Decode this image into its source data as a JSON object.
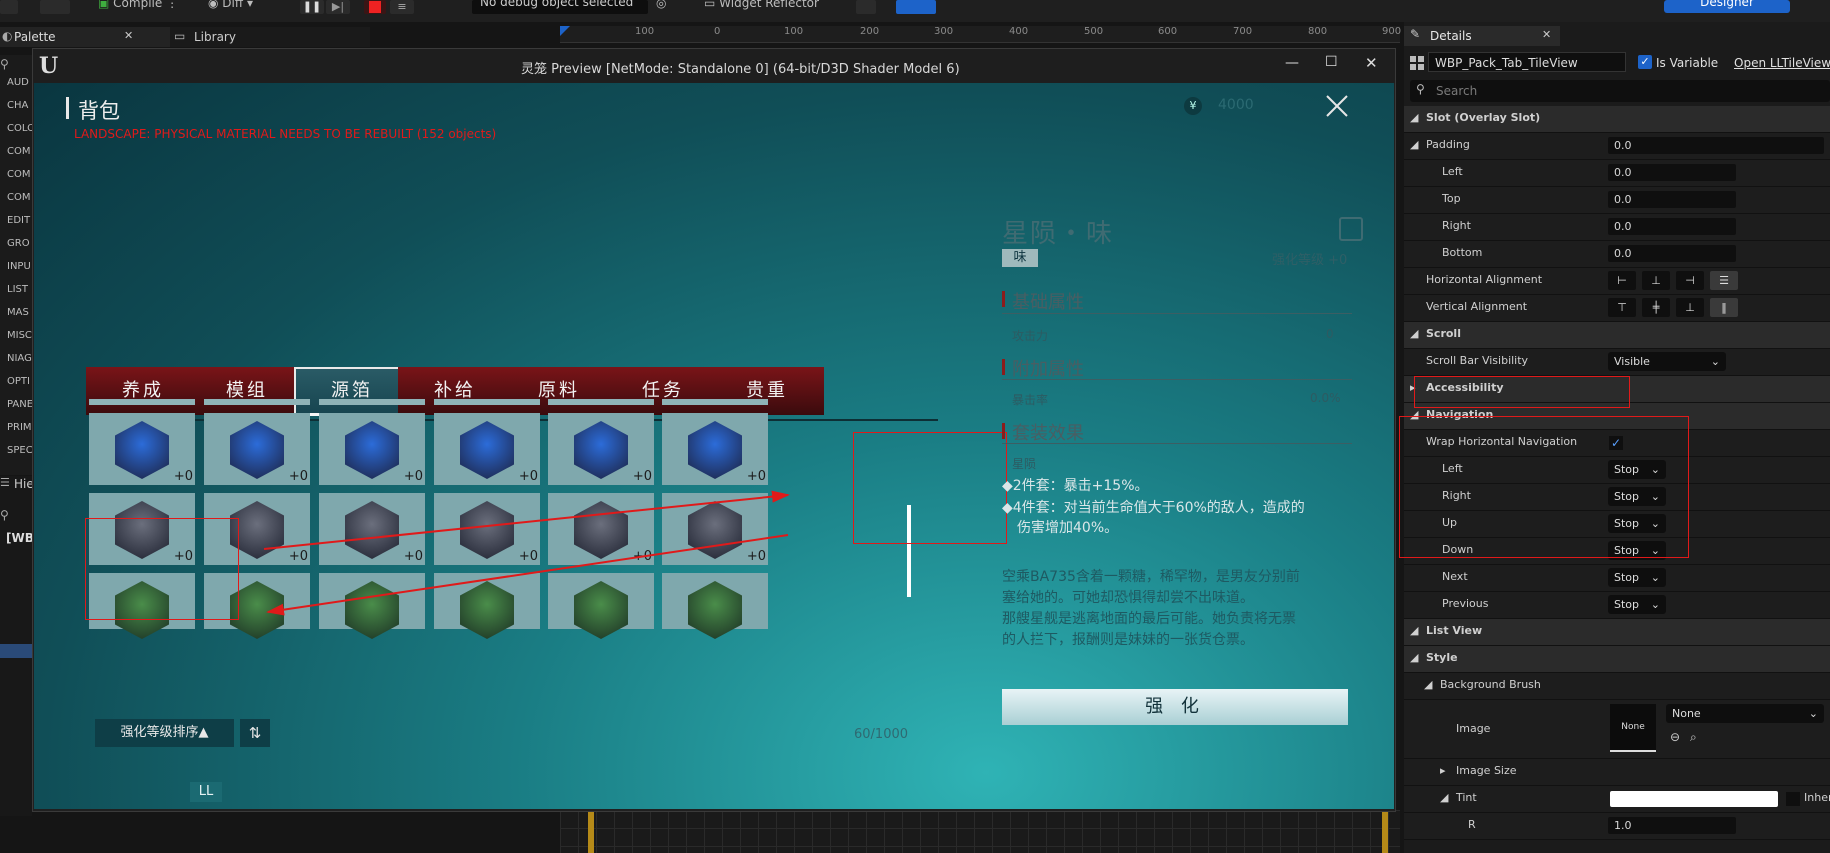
{
  "toolbar": {
    "compile_label": "Compile",
    "diff_label": "Diff",
    "debug_select": "No debug object selected",
    "widget_reflector": "Widget Reflector",
    "designer_label": "Designer"
  },
  "palette": {
    "tab_palette": "Palette",
    "tab_library": "Library",
    "categories": [
      "AUD",
      "CHA",
      "COLO",
      "COM",
      "COM",
      "COM",
      "EDIT",
      "GRO",
      "INPU",
      "LIST",
      "MAS",
      "MISC",
      "NIAG",
      "OPTI",
      "PANE",
      "PRIM",
      "SPEC"
    ],
    "hierarchy_label": "Hie",
    "tree_root": "[WB"
  },
  "ruler": {
    "ticks": [
      "100",
      "0",
      "100",
      "200",
      "300",
      "400",
      "500",
      "600",
      "700",
      "800",
      "900"
    ]
  },
  "preview": {
    "title": "灵笼 Preview [NetMode: Standalone 0]  (64-bit/D3D Shader Model 6)",
    "minimize": "—",
    "maximize": "☐",
    "close": "✕"
  },
  "game": {
    "page_title": "背包",
    "warning": "LANDSCAPE: PHYSICAL MATERIAL NEEDS TO BE REBUILT (152 objects)",
    "currency_icon": "¥",
    "currency_value": "4000",
    "close_icon": "close-x",
    "tabs": [
      "养成",
      "模组",
      "源箔",
      "补给",
      "原料",
      "任务",
      "贵重"
    ],
    "active_tab": 2,
    "item_plus": "+0",
    "sort_button": "强化等级排序▲",
    "sort_icon": "sort-icon",
    "capacity": "60/1000",
    "footer_badge": "LL",
    "detail": {
      "item_name": "星陨・味",
      "item_tag": "味",
      "level_label": "强化等级 +0",
      "base_attr": "基础属性",
      "base_attr_row": "攻击力",
      "base_attr_value": "0",
      "extra_attr": "附加属性",
      "extra_attr_row": "暴击率",
      "extra_attr_value": "0.0%",
      "set_effect": "套装效果",
      "set_name": "星陨",
      "set_2": "◆2件套：暴击+15%。",
      "set_4a": "◆4件套：对当前生命值大于60%的敌人，造成的",
      "set_4b": "伤害增加40%。",
      "desc1": "空乘BA735含着一颗糖，稀罕物，是男友分别前",
      "desc2": "塞给她的。可她却恐惧得却尝不出味道。",
      "desc3": "那艘星舰是逃离地面的最后可能。她负责将无票",
      "desc4": "的人拦下，报酬则是妹妹的一张货仓票。",
      "enhance_button": "强 化"
    }
  },
  "details": {
    "tab_label": "Details",
    "widget_name": "WBP_Pack_Tab_TileView",
    "is_variable_label": "Is Variable",
    "open_link": "Open LLTileView",
    "search_placeholder": "Search",
    "slot_header": "Slot (Overlay Slot)",
    "padding_label": "Padding",
    "padding_value": "0.0",
    "left_label": "Left",
    "left_value": "0.0",
    "top_label": "Top",
    "top_value": "0.0",
    "right_label": "Right",
    "right_value": "0.0",
    "bottom_label": "Bottom",
    "bottom_value": "0.0",
    "halign_label": "Horizontal Alignment",
    "valign_label": "Vertical Alignment",
    "scroll_header": "Scroll",
    "scrollbar_label": "Scroll Bar Visibility",
    "scrollbar_value": "Visible",
    "accessibility_header": "Accessibility",
    "navigation_header": "Navigation",
    "wrap_label": "Wrap Horizontal Navigation",
    "nav_rows": [
      {
        "label": "Left",
        "value": "Stop"
      },
      {
        "label": "Right",
        "value": "Stop"
      },
      {
        "label": "Up",
        "value": "Stop"
      },
      {
        "label": "Down",
        "value": "Stop"
      },
      {
        "label": "Next",
        "value": "Stop"
      },
      {
        "label": "Previous",
        "value": "Stop"
      }
    ],
    "listview_header": "List View",
    "style_header": "Style",
    "bg_brush_label": "Background Brush",
    "image_label": "Image",
    "image_none": "None",
    "image_select": "None",
    "image_size_label": "Image Size",
    "tint_label": "Tint",
    "inherit_label": "Inher",
    "r_label": "R",
    "r_value": "1.0"
  },
  "colors": {
    "accent": "#1d63c9",
    "annotation_red": "#e01a1a",
    "tab_red": "#7a1418",
    "game_teal": "#1a7d84"
  }
}
